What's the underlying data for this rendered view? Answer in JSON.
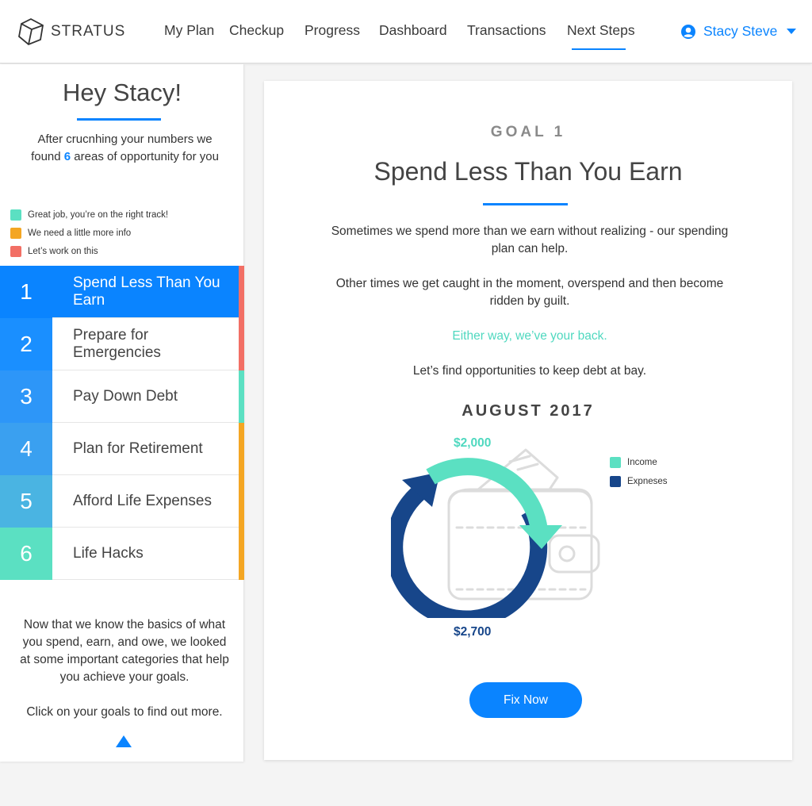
{
  "brand": {
    "name": "STRATUS"
  },
  "nav": {
    "items": [
      "My Plan",
      "Checkup",
      "Progress",
      "Dashboard",
      "Transactions",
      "Next Steps"
    ],
    "active": "Next Steps"
  },
  "user": {
    "name": "Stacy Steve"
  },
  "sidebar": {
    "greeting": "Hey Stacy!",
    "intro_before": "After crucnhing your numbers we found ",
    "intro_count": "6",
    "intro_after": " areas of opportunity for you",
    "legend": [
      {
        "label": "Great job, you’re on the right track!",
        "color": "#5be0c2"
      },
      {
        "label": "We need a little more info",
        "color": "#f4a623"
      },
      {
        "label": "Let’s work on this",
        "color": "#f26f65"
      }
    ],
    "goals": [
      {
        "num": "1",
        "label": "Spend Less Than You Earn",
        "num_color": "#0a84ff",
        "status_color": "#f26f65"
      },
      {
        "num": "2",
        "label": "Prepare for Emergencies",
        "num_color": "#1a8fff",
        "status_color": "#f26f65"
      },
      {
        "num": "3",
        "label": "Pay Down Debt",
        "num_color": "#2d96f8",
        "status_color": "#5be0c2"
      },
      {
        "num": "4",
        "label": "Plan for Retirement",
        "num_color": "#3aa0f0",
        "status_color": "#f4a623"
      },
      {
        "num": "5",
        "label": "Afford Life Expenses",
        "num_color": "#4ab4e2",
        "status_color": "#f4a623"
      },
      {
        "num": "6",
        "label": "Life Hacks",
        "num_color": "#5be0c2",
        "status_color": "#f4a623"
      }
    ],
    "outro_1": "Now that we know the basics of what you spend, earn, and owe, we looked at some important categories that help you achieve your goals.",
    "outro_2": "Click on your goals to find out more."
  },
  "goal_detail": {
    "kicker": "GOAL 1",
    "title": "Spend Less Than You Earn",
    "para_1": "Sometimes we spend more than we earn without realizing - our spending plan can help.",
    "para_2": "Other times we get caught in the moment, overspend and then become ridden by guilt.",
    "para_3": "Either way, we’ve your back.",
    "para_4": "Let’s find opportunities to keep debt at bay.",
    "period": "AUGUST 2017",
    "income_amount": "$2,000",
    "expense_amount": "$2,700",
    "legend": [
      {
        "label": "Income",
        "color": "#5be0c2"
      },
      {
        "label": "Expneses",
        "color": "#17468a"
      }
    ],
    "button": "Fix Now"
  },
  "colors": {
    "accent": "#0a84ff",
    "teal": "#5be0c2",
    "navy": "#17468a",
    "orange": "#f4a623",
    "red": "#f26f65"
  }
}
